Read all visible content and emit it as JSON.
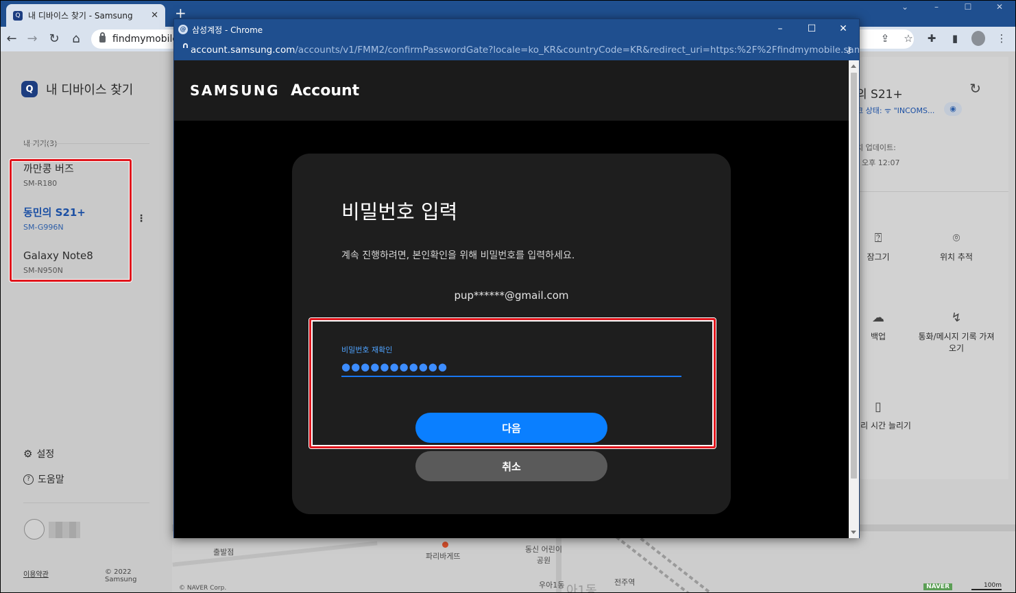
{
  "background_browser": {
    "tab_title": "내 디바이스 찾기 - Samsung",
    "url_text": "findmymobile"
  },
  "sidebar": {
    "app_title": "내 디바이스 찾기",
    "section_label": "내 기기(3)",
    "devices": [
      {
        "name": "까만콩 버즈",
        "model": "SM-R180"
      },
      {
        "name": "동민의 S21+",
        "model": "SM-G996N"
      },
      {
        "name": "Galaxy Note8",
        "model": "SM-N950N"
      }
    ],
    "settings_label": "설정",
    "help_label": "도움말",
    "terms_label": "이용약관",
    "copyright": "© 2022 Samsung"
  },
  "right_panel": {
    "device_title": "의 S21+",
    "status_text": "크 상태: ᯤ \"INCOMS...",
    "update_label": "치 업데이트:",
    "update_time": "오후 12:07",
    "actions": [
      "잠그기",
      "위치 추적",
      "백업",
      "통화/메시지 기록 가져오기",
      "배터리 시간 늘리기"
    ]
  },
  "map": {
    "labels": [
      "출발점",
      "파리바게뜨",
      "동신 어린이공원",
      "우아1동",
      "전주역",
      "아1동"
    ],
    "attribution": "© NAVER Corp.",
    "brand": "NAVER",
    "scale": "100m"
  },
  "popup": {
    "window_title": "삼성계정 - Chrome",
    "url_host": "account.samsung.com",
    "url_path": "/accounts/v1/FMM2/confirmPasswordGate?locale=ko_KR&countryCode=KR&redirect_uri=https:%2F%2Ffindmymobile.sam...",
    "brand_samsung": "SAMSUNG",
    "brand_account": "Account",
    "heading": "비밀번호 입력",
    "description": "계속 진행하려면, 본인확인을 위해 비밀번호를 입력하세요.",
    "email": "pup******@gmail.com",
    "password_label": "비밀번호 재확인",
    "password_value": "●●●●●●●●●●●",
    "next_button": "다음",
    "cancel_button": "취소"
  },
  "colors": {
    "accent_blue": "#0a7fff",
    "highlight_red": "#e0151c",
    "chrome_titlebar": "#1f4f8f"
  }
}
